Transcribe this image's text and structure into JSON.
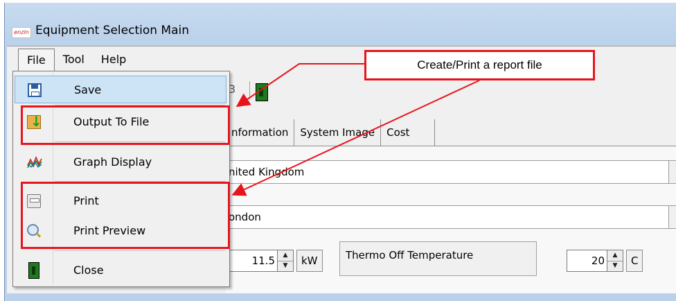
{
  "window": {
    "title": "Equipment Selection Main",
    "logo_text": "enzin"
  },
  "menubar": {
    "items": [
      "File",
      "Tool",
      "Help"
    ]
  },
  "toolbar": {
    "partial_number": "3"
  },
  "tabs": [
    "nformation",
    "System Image",
    "Cost"
  ],
  "fields": {
    "country": "nited Kingdom",
    "city": "ondon"
  },
  "capacity": {
    "value": "11.5",
    "unit": "kW"
  },
  "thermo": {
    "label": "Thermo Off Temperature",
    "value": "20",
    "unit": "C"
  },
  "file_menu": {
    "items": [
      {
        "label": "Save",
        "icon": "save-icon",
        "highlighted": true
      },
      {
        "label": "Output To File",
        "icon": "output-file-icon"
      },
      {
        "label": "Graph Display",
        "icon": "graph-icon"
      },
      {
        "label": "Print",
        "icon": "printer-icon"
      },
      {
        "label": "Print Preview",
        "icon": "print-preview-icon"
      },
      {
        "label": "Close",
        "icon": "exit-door-icon"
      }
    ]
  },
  "annotation": {
    "callout_text": "Create/Print a report file",
    "color": "#e8141c"
  }
}
